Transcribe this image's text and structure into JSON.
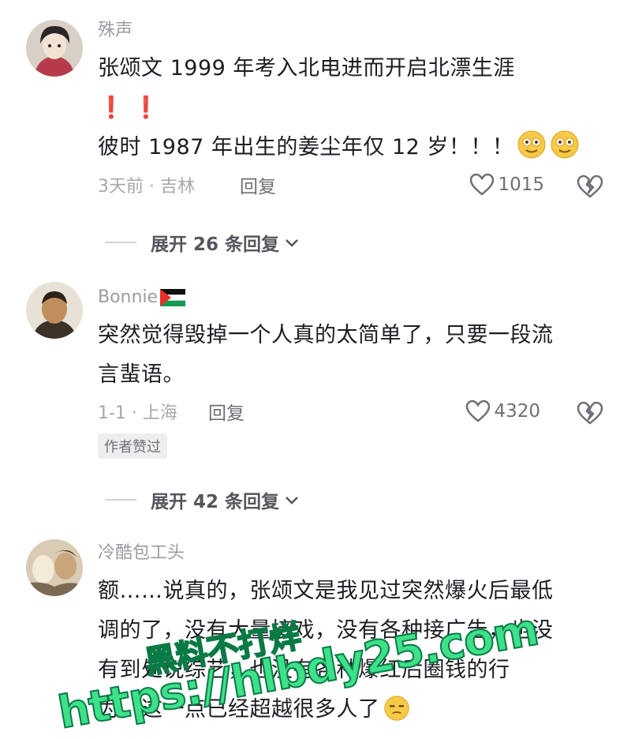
{
  "comments": [
    {
      "username": "殊声",
      "lines": [
        "张颂文 1999 年考入北电进而开启北漂生涯",
        "❗ ❗",
        "彼时 1987 年出生的姜尘年仅 12 岁！！！"
      ],
      "meta": "3天前 · 吉林",
      "reply_label": "回复",
      "likes": "1015",
      "expand_label": "展开 26 条回复"
    },
    {
      "username": "Bonnie",
      "lines": [
        "突然觉得毁掉一个人真的太简单了，只要一段流",
        "言蜚语。"
      ],
      "meta": "1-1 · 上海",
      "reply_label": "回复",
      "likes": "4320",
      "badge": "作者赞过",
      "expand_label": "展开 42 条回复"
    },
    {
      "username": "冷酷包工头",
      "lines": [
        "额……说真的，张颂文是我见过突然爆火后最低",
        "调的了，没有大量接戏，没有各种接广告，也没",
        "有到处说综艺，也没有各种爆红后圈钱的行",
        "为，这一点已经超越很多人了"
      ]
    }
  ],
  "watermark": {
    "line1": "黑料不打烊",
    "line2": "https://hlbdy25.com"
  },
  "icons": [
    "heart-outline-icon",
    "broken-heart-icon",
    "chevron-down-icon",
    "palestine-flag-icon",
    "smile-emoji-icon",
    "squint-emoji-icon"
  ]
}
